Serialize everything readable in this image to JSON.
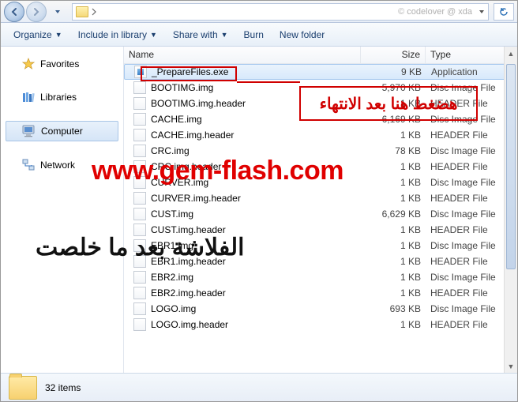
{
  "nav": {
    "watermark": "© codelover @ xda"
  },
  "toolbar": {
    "organize": "Organize",
    "include": "Include in library",
    "share": "Share with",
    "burn": "Burn",
    "newfolder": "New folder"
  },
  "sidebar": {
    "favorites": "Favorites",
    "libraries": "Libraries",
    "computer": "Computer",
    "network": "Network"
  },
  "columns": {
    "name": "Name",
    "size": "Size",
    "type": "Type"
  },
  "files": [
    {
      "name": "_PrepareFiles.exe",
      "size": "9 KB",
      "type": "Application",
      "icon": "exe",
      "sel": true
    },
    {
      "name": "BOOTIMG.img",
      "size": "5,970 KB",
      "type": "Disc Image File",
      "icon": "file"
    },
    {
      "name": "BOOTIMG.img.header",
      "size": "1 KB",
      "type": "HEADER File",
      "icon": "file"
    },
    {
      "name": "CACHE.img",
      "size": "6,169 KB",
      "type": "Disc Image File",
      "icon": "file"
    },
    {
      "name": "CACHE.img.header",
      "size": "1 KB",
      "type": "HEADER File",
      "icon": "file"
    },
    {
      "name": "CRC.img",
      "size": "78 KB",
      "type": "Disc Image File",
      "icon": "file"
    },
    {
      "name": "CRC.img.header",
      "size": "1 KB",
      "type": "HEADER File",
      "icon": "file"
    },
    {
      "name": "CURVER.img",
      "size": "1 KB",
      "type": "Disc Image File",
      "icon": "file"
    },
    {
      "name": "CURVER.img.header",
      "size": "1 KB",
      "type": "HEADER File",
      "icon": "file"
    },
    {
      "name": "CUST.img",
      "size": "6,629 KB",
      "type": "Disc Image File",
      "icon": "file"
    },
    {
      "name": "CUST.img.header",
      "size": "1 KB",
      "type": "HEADER File",
      "icon": "file"
    },
    {
      "name": "EBR1.img",
      "size": "1 KB",
      "type": "Disc Image File",
      "icon": "file"
    },
    {
      "name": "EBR1.img.header",
      "size": "1 KB",
      "type": "HEADER File",
      "icon": "file"
    },
    {
      "name": "EBR2.img",
      "size": "1 KB",
      "type": "Disc Image File",
      "icon": "file"
    },
    {
      "name": "EBR2.img.header",
      "size": "1 KB",
      "type": "HEADER File",
      "icon": "file"
    },
    {
      "name": "LOGO.img",
      "size": "693 KB",
      "type": "Disc Image File",
      "icon": "file"
    },
    {
      "name": "LOGO.img.header",
      "size": "1 KB",
      "type": "HEADER File",
      "icon": "file"
    }
  ],
  "footer": {
    "count": "32 items"
  },
  "annotations": {
    "red_arabic": "هضغط هنا بعد الانتهاء",
    "url": "www.gem-flash.com",
    "black_arabic": "الفلاشة بعد ما خلصت"
  }
}
